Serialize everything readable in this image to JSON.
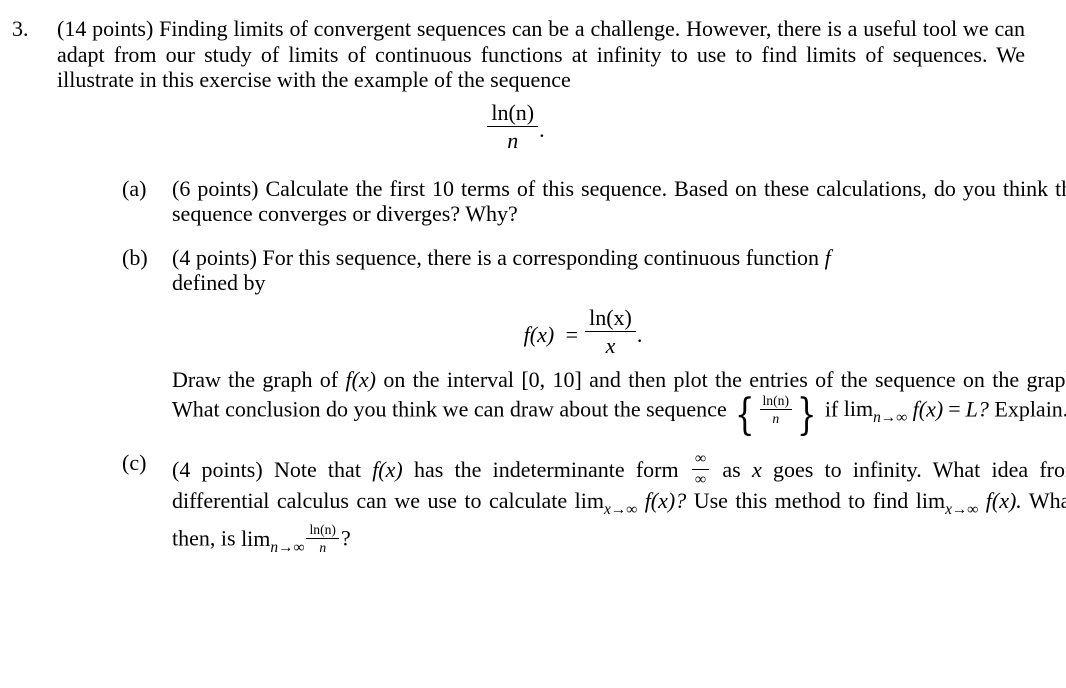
{
  "document": {
    "problem_number": "3.",
    "intro": {
      "points": "(14 points)",
      "text": "Finding limits of convergent sequences can be a challenge. However, there is a useful tool we can adapt from our study of limits of continuous functions at infinity to use to find limits of sequences. We illustrate in this exercise with the example of the sequence"
    },
    "display_eq_1": {
      "numerator": "ln(n)",
      "denominator": "n",
      "trailing": "."
    },
    "parts": [
      {
        "label": "(a)",
        "points": "(6 points)",
        "text": "Calculate the first 10 terms of this sequence. Based on these calculations, do you think the sequence converges or diverges? Why?"
      },
      {
        "label": "(b)",
        "points": "(4 points)",
        "text_before": "For this sequence, there is a corresponding continuous function",
        "function_symbol": "f",
        "text_defined_by": "defined by",
        "display_eq": {
          "lhs": "f(x)",
          "equals": "=",
          "numerator": "ln(x)",
          "denominator": "x",
          "trailing": "."
        },
        "body_1": "Draw the graph of",
        "body_fx": "f(x)",
        "body_2": "on the interval",
        "interval": "[0, 10]",
        "body_3": "and then plot the entries of the sequence on the graph. What conclusion do you think we can draw about the sequence",
        "set_numerator": "ln(n)",
        "set_denominator": "n",
        "body_4": "if",
        "limit_op": "lim",
        "limit_sub_n": "n→∞",
        "limit_fx": "f(x)",
        "limit_equals": "=",
        "limit_value": "L?",
        "body_5": "Explain."
      },
      {
        "label": "(c)",
        "points": "(4 points)",
        "text_1": "Note that",
        "fx": "f(x)",
        "text_2": "has the indeterminante form",
        "indeterminate_numerator": "∞",
        "indeterminate_denominator": "∞",
        "text_3": "as",
        "var_x": "x",
        "text_4": "goes to infinity. What idea from differential calculus can we use to calculate",
        "limit_op": "lim",
        "limit_sub_x": "x→∞",
        "limit_fx": "f(x)?",
        "text_5": "Use this method to find",
        "limit_op_2": "lim",
        "limit_sub_x_2": "x→∞",
        "limit_fx_2": "f(x).",
        "text_6": "What, then, is",
        "limit_op_3": "lim",
        "limit_sub_n_3": "n→∞",
        "final_numerator": "ln(n)",
        "final_denominator": "n",
        "final_question": "?"
      }
    ]
  }
}
